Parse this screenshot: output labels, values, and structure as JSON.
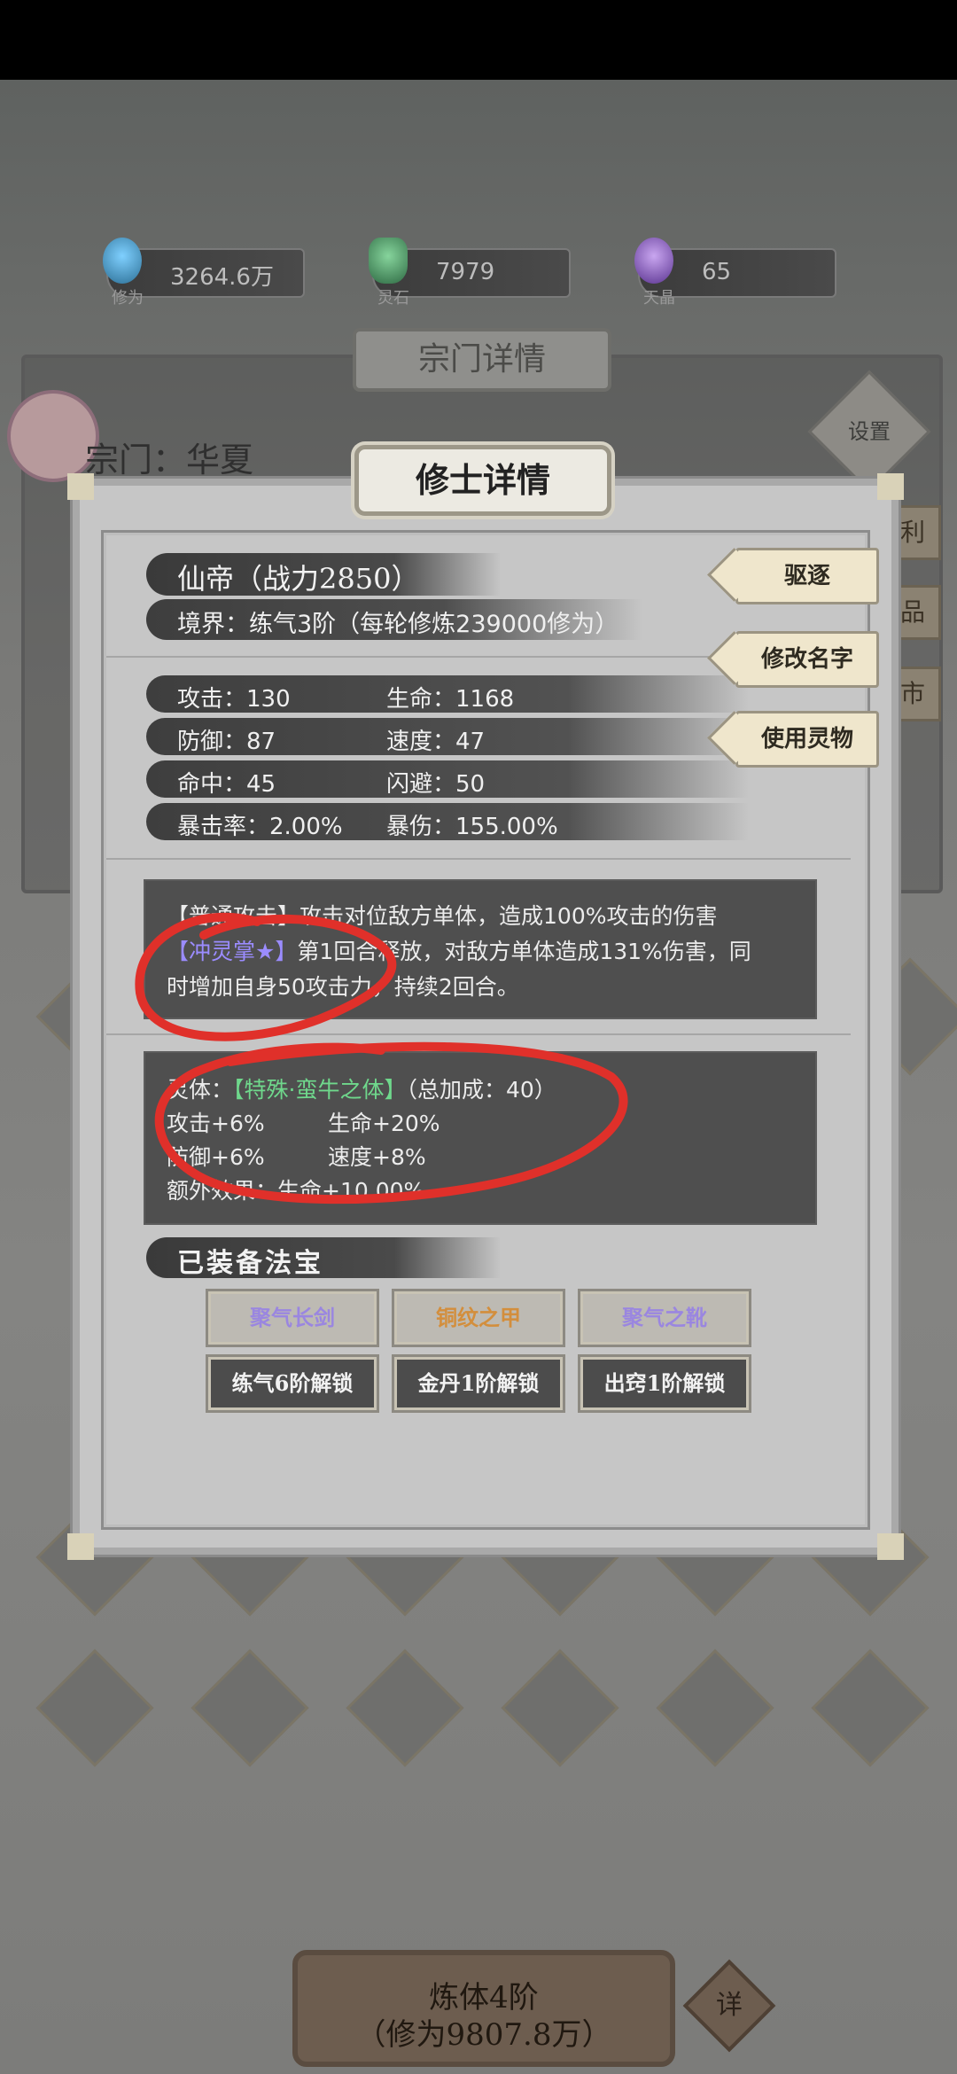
{
  "resources": [
    {
      "value": "3264.6万",
      "caption": "修为",
      "color": "#3d8fb8"
    },
    {
      "value": "7979",
      "caption": "灵石",
      "color": "#3f8a5a"
    },
    {
      "value": "65",
      "caption": "天晶",
      "color": "#7a4fb0"
    }
  ],
  "background": {
    "panel_title": "宗门详情",
    "sect_label": "宗门：华夏",
    "settings_label": "设置",
    "side_buttons": [
      "利",
      "品",
      "市"
    ],
    "bottom_button": {
      "line1": "炼体4阶",
      "line2": "（修为9807.8万）"
    },
    "detail_label": "详"
  },
  "modal": {
    "title": "修士详情",
    "name_line": "仙帝（战力2850）",
    "realm_line": "境界：练气3阶（每轮修炼239000修为）",
    "stats": [
      {
        "left": "攻击：130",
        "right": "生命：1168"
      },
      {
        "left": "防御：87",
        "right": "速度：47"
      },
      {
        "left": "命中：45",
        "right": "闪避：50"
      },
      {
        "left": "暴击率：2.00%",
        "right": "暴伤：155.00%"
      }
    ],
    "actions": [
      "驱逐",
      "修改名字",
      "使用灵物"
    ],
    "skills": {
      "line1": "【普通攻击】攻击对位敌方单体，造成100%攻击的伤害",
      "line2_name": "【冲灵掌★】",
      "line2_rest": "第1回合释放，对敌方单体造成131%伤害，同",
      "line3": "时增加自身50攻击力，持续2回合。"
    },
    "spirit_body": {
      "label": "灵体：",
      "type": "【特殊·蛮牛之体】",
      "bonus": "（总加成：40）",
      "attack": "攻击+6%",
      "hp": "生命+20%",
      "defense": "防御+6%",
      "speed": "速度+8%",
      "extra": "额外效果：生命+10.00%"
    },
    "equip_title": "已装备法宝",
    "equipment": [
      {
        "label": "聚气长剑",
        "color": "#9a86e0"
      },
      {
        "label": "铜纹之甲",
        "color": "#d38e3c"
      },
      {
        "label": "聚气之靴",
        "color": "#9a86e0"
      }
    ],
    "locked_slots": [
      "练气6阶解锁",
      "金丹1阶解锁",
      "出窍1阶解锁"
    ]
  },
  "annotation_color": "#e0302a"
}
